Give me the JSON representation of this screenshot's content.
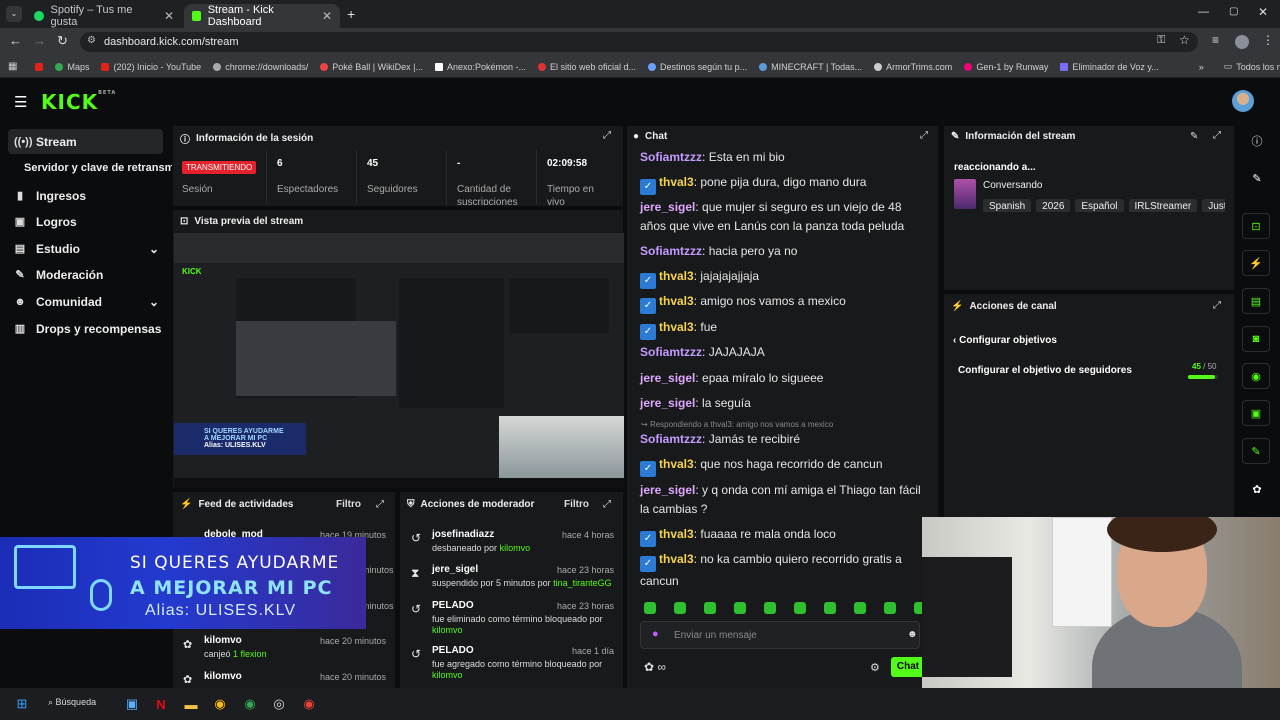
{
  "browser": {
    "tabs": [
      {
        "title": "Spotify – Tus me gusta"
      },
      {
        "title": "Stream - Kick Dashboard"
      }
    ],
    "url": "dashboard.kick.com/stream",
    "bookmarks": [
      "Maps",
      "(202) Inicio - YouTube",
      "chrome://downloads/",
      "Poké Ball | WikiDex |...",
      "Anexo:Pokémon -...",
      "El sitio web oficial d...",
      "Destinos según tu p...",
      "MINECRAFT | Todas...",
      "ArmorTrims.com",
      "Gen-1 by Runway",
      "Eliminador de Voz y..."
    ],
    "bookmarks_folder": "Todos los marcadores"
  },
  "brand": {
    "logo": "KICK",
    "beta": "BETA",
    "accent": "#53fc18"
  },
  "sidebar": {
    "items": [
      {
        "label": "Stream",
        "icon": "broadcast-icon"
      },
      {
        "label": "Servidor y clave de retransmisión"
      },
      {
        "label": "Ingresos",
        "icon": "chart-icon"
      },
      {
        "label": "Logros",
        "icon": "trophy-icon"
      },
      {
        "label": "Estudio",
        "icon": "studio-icon"
      },
      {
        "label": "Moderación",
        "icon": "wrench-icon"
      },
      {
        "label": "Comunidad",
        "icon": "people-icon"
      },
      {
        "label": "Drops y recompensas",
        "icon": "gift-icon"
      }
    ]
  },
  "session": {
    "title": "Información de la sesión",
    "status": "TRANSMITIENDO",
    "status_label": "Sesión",
    "stats": [
      {
        "value": "6",
        "label": "Espectadores"
      },
      {
        "value": "45",
        "label": "Seguidores"
      },
      {
        "value": "-",
        "label": "Cantidad de suscripciones"
      },
      {
        "value": "02:09:58",
        "label": "Tiempo en vivo"
      }
    ]
  },
  "preview": {
    "title": "Vista previa del stream",
    "overlay_line1": "SI QUERES AYUDARME",
    "overlay_line2": "A MEJORAR MI PC",
    "overlay_line3": "Alias: ULISES.KLV"
  },
  "chat": {
    "title": "Chat",
    "messages": [
      {
        "user": "Sofiamtzzz",
        "text": "Esta en mi bio",
        "badge": false
      },
      {
        "user": "thval3",
        "text": "pone pija dura, digo mano dura",
        "badge": true
      },
      {
        "user": "jere_sigel",
        "text": "que mujer si seguro es un viejo de 48 años que vive en Lanús con la panza toda peluda",
        "badge": false
      },
      {
        "user": "Sofiamtzzz",
        "text": "hacia pero ya no",
        "badge": false
      },
      {
        "user": "thval3",
        "text": "jajajajajjaja",
        "badge": true
      },
      {
        "user": "thval3",
        "text": "amigo nos vamos a mexico",
        "badge": true
      },
      {
        "user": "thval3",
        "text": "fue",
        "badge": true
      },
      {
        "user": "Sofiamtzzz",
        "text": "JAJAJAJA",
        "badge": false
      },
      {
        "user": "jere_sigel",
        "text": "epaa míralo lo sigueee",
        "badge": false
      },
      {
        "user": "jere_sigel",
        "text": "la seguía",
        "badge": false
      },
      {
        "user": "Sofiamtzzz",
        "text": "Jamás te recibiré",
        "badge": false,
        "reply": "Respondiendo a thval3: amigo nos vamos a mexico"
      },
      {
        "user": "thval3",
        "text": "que nos haga recorrido de cancun",
        "badge": true
      },
      {
        "user": "jere_sigel",
        "text": "y q onda con mí amiga el Thiago tan fácil la cambias ?",
        "badge": false
      },
      {
        "user": "thval3",
        "text": "fuaaaa re mala onda loco",
        "badge": true
      },
      {
        "user": "thval3",
        "text": "no ka cambio quiero recorrido gratis a cancun",
        "badge": true
      }
    ],
    "input_placeholder": "Enviar un mensaje",
    "send_label": "Chat"
  },
  "stream_info": {
    "title": "Información del stream",
    "reacting": "reaccionando a...",
    "category": "Conversando",
    "tags": [
      "Spanish",
      "2026",
      "Español",
      "IRLStreamer",
      "JustC"
    ]
  },
  "channel_actions": {
    "title": "Acciones de canal",
    "back_label": "Configurar objetivos",
    "goal_label": "Configurar el objetivo de seguidores",
    "goal_current": "45",
    "goal_total": "/ 50",
    "goal_progress": 0.9
  },
  "activity_feed": {
    "title": "Feed de actividades",
    "filter": "Filtro",
    "items": [
      {
        "user": "debole_mod",
        "time": "hace 19 minutos",
        "desc": ""
      },
      {
        "user": "kilomvo",
        "time": "hace 20 minutos",
        "desc_pre": "canjeó",
        "desc_hl": "1 flexion"
      },
      {
        "user": "kilomvo",
        "time": "hace 20 minutos",
        "desc": ""
      }
    ],
    "hidden_times": [
      "minutos",
      "minutos"
    ]
  },
  "overlay": {
    "line1": "SI QUERES AYUDARME",
    "line2": "A MEJORAR MI PC",
    "line3": "Alias: ULISES.KLV"
  },
  "mod_actions": {
    "title": "Acciones de moderador",
    "filter": "Filtro",
    "items": [
      {
        "user": "josefinadiazz",
        "time": "hace 4 horas",
        "desc_pre": "desbaneado por",
        "desc_hl": "kilomvo"
      },
      {
        "user": "jere_sigel",
        "time": "hace 23 horas",
        "desc_pre": "suspendido por 5 minutos por",
        "desc_hl": "tina_tiranteGG"
      },
      {
        "user": "PELADO",
        "time": "hace 23 horas",
        "desc_pre": "fue eliminado como término bloqueado por",
        "desc_hl": "kilomvo"
      },
      {
        "user": "PELADO",
        "time": "hace 1 día",
        "desc_pre": "fue agregado como término bloqueado por",
        "desc_hl": "kilomvo"
      }
    ]
  },
  "taskbar": {
    "search": "Búsqueda"
  }
}
